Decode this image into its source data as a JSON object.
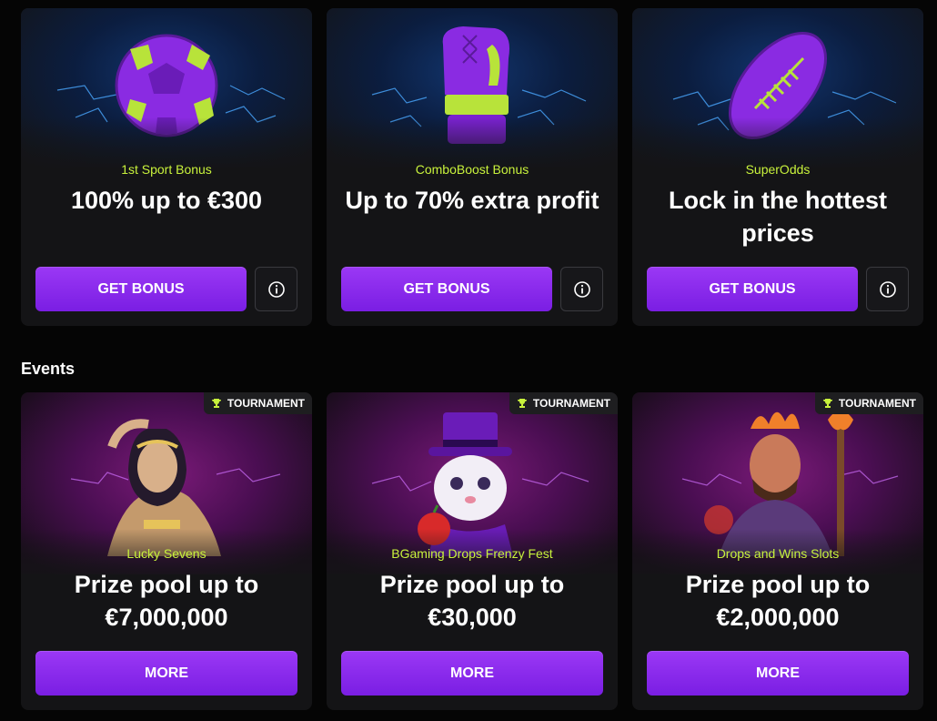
{
  "bonuses": [
    {
      "icon": "soccer-ball-icon",
      "subtitle": "1st Sport Bonus",
      "headline": "100% up to €300",
      "button_label": "GET BONUS",
      "info_icon": "info-icon"
    },
    {
      "icon": "boxing-glove-icon",
      "subtitle": "ComboBoost Bonus",
      "headline": "Up to 70% extra profit",
      "button_label": "GET BONUS",
      "info_icon": "info-icon"
    },
    {
      "icon": "american-football-icon",
      "subtitle": "SuperOdds",
      "headline": "Lock in the hottest prices",
      "button_label": "GET BONUS",
      "info_icon": "info-icon"
    }
  ],
  "events_section": {
    "title": "Events"
  },
  "events": [
    {
      "badge_icon": "trophy-icon",
      "badge_label": "TOURNAMENT",
      "subtitle": "Lucky Sevens",
      "headline": "Prize pool up to €7,000,000",
      "button_label": "MORE"
    },
    {
      "badge_icon": "trophy-icon",
      "badge_label": "TOURNAMENT",
      "subtitle": "BGaming Drops Frenzy Fest",
      "headline": "Prize pool up to €30,000",
      "button_label": "MORE"
    },
    {
      "badge_icon": "trophy-icon",
      "badge_label": "TOURNAMENT",
      "subtitle": "Drops and Wins Slots",
      "headline": "Prize pool up to €2,000,000",
      "button_label": "MORE"
    }
  ],
  "colors": {
    "accent_green": "#c8f23c",
    "button_purple": "#8a2be2",
    "card_bg": "#141416",
    "page_bg": "#050505"
  }
}
